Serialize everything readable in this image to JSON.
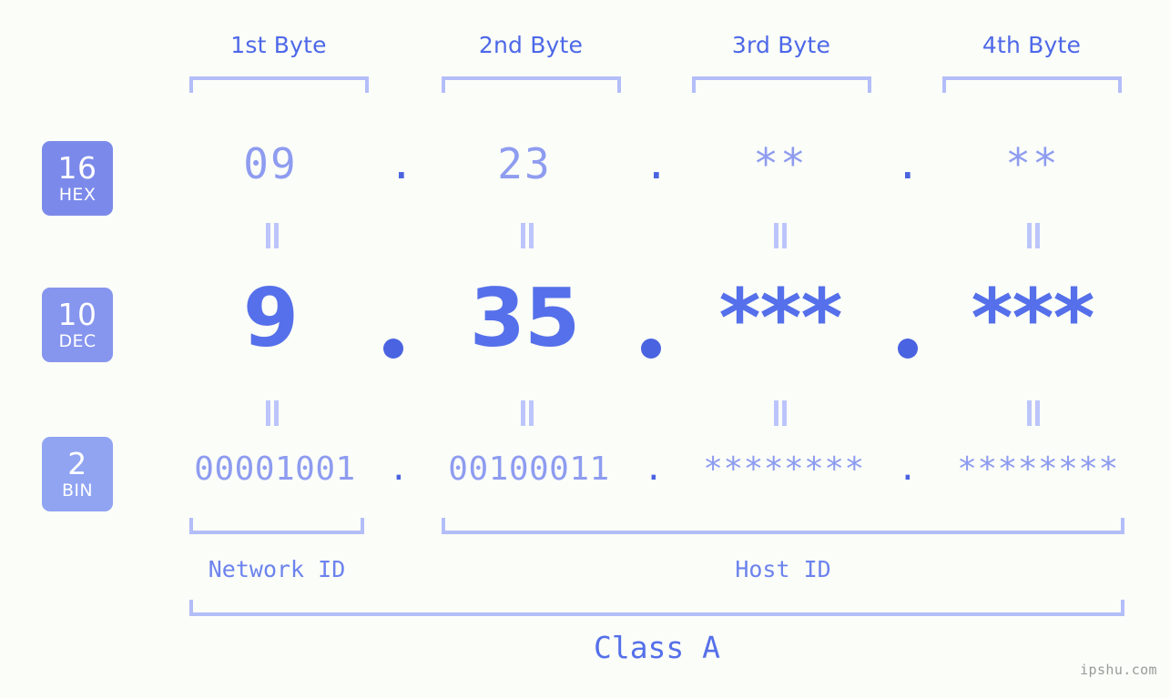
{
  "watermark": "ipshu.com",
  "byte_headers": [
    {
      "label": "1st Byte"
    },
    {
      "label": "2nd Byte"
    },
    {
      "label": "3rd Byte"
    },
    {
      "label": "4th Byte"
    }
  ],
  "bases": [
    {
      "number": "16",
      "unit": "HEX",
      "color": "#7b8aea"
    },
    {
      "number": "10",
      "unit": "DEC",
      "color": "#8695ee"
    },
    {
      "number": "2",
      "unit": "BIN",
      "color": "#90a4f2"
    }
  ],
  "rows": {
    "hex": {
      "base_number": "16",
      "base_unit": "HEX",
      "values": [
        "09",
        "23",
        "**",
        "**"
      ],
      "separator": "."
    },
    "dec": {
      "base_number": "10",
      "base_unit": "DEC",
      "values": [
        "9",
        "35",
        "***",
        "***"
      ],
      "separator": "."
    },
    "bin": {
      "base_number": "2",
      "base_unit": "BIN",
      "values": [
        "00001001",
        "00100011",
        "********",
        "********"
      ],
      "separator": "."
    }
  },
  "equals_marks": {
    "glyph": "=",
    "count_per_row": 4
  },
  "sections": [
    {
      "label": "Network ID"
    },
    {
      "label": "Host ID"
    }
  ],
  "class": {
    "label": "Class A"
  },
  "colors": {
    "background": "#fbfdf8",
    "accent_strong": "#4a63e0",
    "accent_mid": "#5570ea",
    "accent_light": "#8e9cf0",
    "bracket": "#b3bef9",
    "header_text": "#4d68e8",
    "watermark_text": "#9a9a9a"
  }
}
